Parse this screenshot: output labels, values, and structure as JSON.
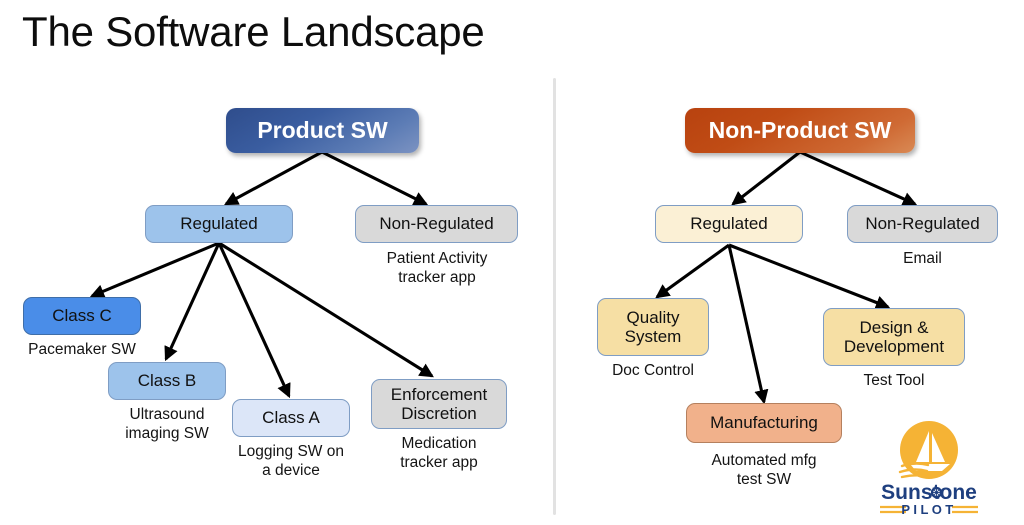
{
  "slide": {
    "title": "The Software Landscape",
    "background": "#ffffff"
  },
  "colors": {
    "product_root": "#3a5da0",
    "nonproduct_root": "#c04c15",
    "blue_mid": "#9dc3eb",
    "blue_dark": "#4a8de8",
    "blue_light": "#dce6f8",
    "gray": "#d9d9d9",
    "cream": "#fbf0d5",
    "gold": "#f6dfa4",
    "salmon": "#f1b18b",
    "border": "#7f9dc4",
    "divider": "#e2e2e2",
    "logo_gold": "#f5b335",
    "logo_navy": "#1e3f7f"
  },
  "left_tree": {
    "root": {
      "label": "Product SW"
    },
    "regulated": {
      "label": "Regulated"
    },
    "non_regulated": {
      "label": "Non-Regulated",
      "caption": "Patient Activity\ntracker app"
    },
    "children": [
      {
        "label": "Class C",
        "caption": "Pacemaker SW"
      },
      {
        "label": "Class B",
        "caption": "Ultrasound\nimaging SW"
      },
      {
        "label": "Class A",
        "caption": "Logging SW on\na device"
      },
      {
        "label": "Enforcement\nDiscretion",
        "caption": "Medication\ntracker app"
      }
    ]
  },
  "right_tree": {
    "root": {
      "label": "Non-Product SW"
    },
    "regulated": {
      "label": "Regulated"
    },
    "non_regulated": {
      "label": "Non-Regulated",
      "caption": "Email"
    },
    "children": [
      {
        "label": "Quality\nSystem",
        "caption": "Doc Control"
      },
      {
        "label": "Manufacturing",
        "caption": "Automated mfg\ntest SW"
      },
      {
        "label": "Design &\nDevelopment",
        "caption": "Test Tool"
      }
    ]
  },
  "logo": {
    "wordmark": "Sunstone",
    "wordmark_prefix": "Sunst",
    "wordmark_suffix": "ne",
    "subtitle": "PILOT",
    "mark": "sailboat-in-sun-circle"
  }
}
